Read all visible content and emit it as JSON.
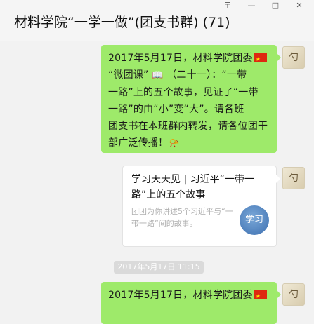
{
  "window": {
    "controls": [
      "〒",
      "—",
      "□",
      "✕"
    ],
    "title": "材料学院“一学一做”(团支书群) (71)"
  },
  "messages": [
    {
      "type": "text",
      "line1": "2017年5月17日，材料学院团委",
      "line2_prefix": "“微团课”",
      "line2_suffix": "（二十一）：“一带",
      "line3": "一路”上的五个故事，见证了“一带",
      "line4": "一路”的由“小”变“大”。请各班",
      "line5": "团支书在本班群内转发，请各位团干",
      "line6_prefix": "部广泛传播！",
      "icons": {
        "flag": "china-flag-icon",
        "book": "book-icon",
        "horn": "trumpet-icon"
      }
    },
    {
      "type": "link-card",
      "title": "学习天天见 | 习近平“一带一路”上的五个故事",
      "description": "团团为你讲述5个习近平与“一带一路”间的故事。",
      "thumb_text": "学习"
    },
    {
      "type": "timestamp",
      "text": "2017年5月17日 11:15"
    },
    {
      "type": "text",
      "line1": "2017年5月17日，材料学院团委"
    }
  ],
  "avatar_text": "勺"
}
